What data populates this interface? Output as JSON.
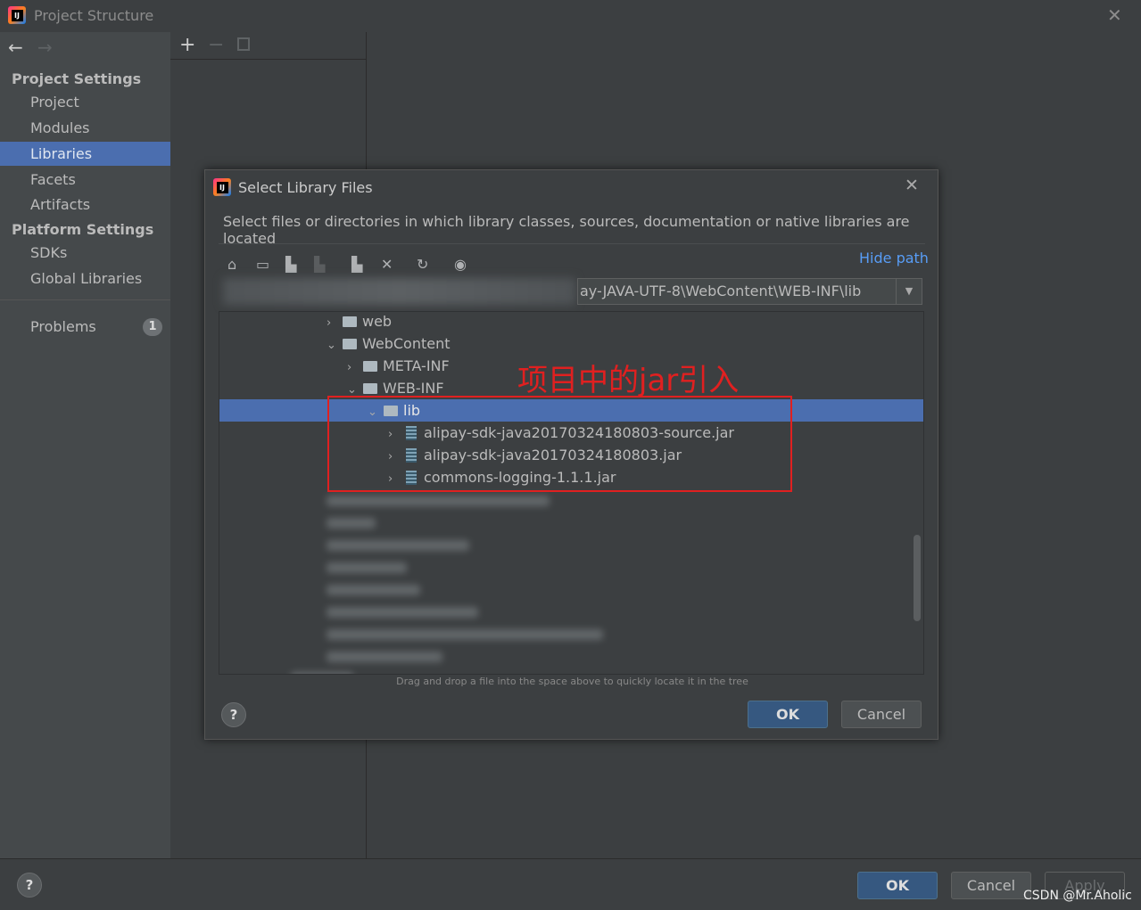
{
  "window": {
    "title": "Project Structure"
  },
  "sidebar": {
    "project_settings": "Project Settings",
    "items": [
      "Project",
      "Modules",
      "Libraries",
      "Facets",
      "Artifacts"
    ],
    "platform_settings": "Platform Settings",
    "platform_items": [
      "SDKs",
      "Global Libraries"
    ],
    "problems": "Problems",
    "problems_count": "1",
    "selected": "Libraries"
  },
  "footer": {
    "ok": "OK",
    "cancel": "Cancel",
    "apply": "Apply"
  },
  "dialog": {
    "title": "Select Library Files",
    "description": "Select files or directories in which library classes, sources, documentation or native libraries are located",
    "hide_path": "Hide path",
    "path_value": "ay-JAVA-UTF-8\\WebContent\\WEB-INF\\lib",
    "hint": "Drag and drop a file into the space above to quickly locate it in the tree",
    "ok": "OK",
    "cancel": "Cancel",
    "tree": [
      {
        "label": "web",
        "type": "folder",
        "expanded": false
      },
      {
        "label": "WebContent",
        "type": "folder",
        "expanded": true
      },
      {
        "label": "META-INF",
        "type": "folder",
        "expanded": false
      },
      {
        "label": "WEB-INF",
        "type": "folder",
        "expanded": true
      },
      {
        "label": "lib",
        "type": "folder",
        "expanded": true,
        "selected": true
      },
      {
        "label": "alipay-sdk-java20170324180803-source.jar",
        "type": "jar"
      },
      {
        "label": "alipay-sdk-java20170324180803.jar",
        "type": "jar"
      },
      {
        "label": "commons-logging-1.1.1.jar",
        "type": "jar"
      }
    ],
    "annotation": "项目中的jar引入"
  },
  "colors": {
    "accent": "#4b6eaf",
    "annotation": "#e02020",
    "link": "#589df6"
  },
  "watermark": "CSDN @Mr.Aholic"
}
